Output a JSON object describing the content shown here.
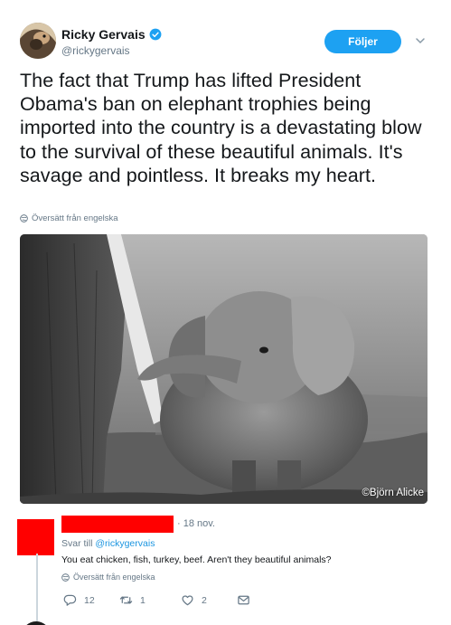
{
  "tweet": {
    "author_name": "Ricky Gervais",
    "author_handle": "@rickygervais",
    "follow_label": "Följer",
    "text": "The fact that Trump has lifted President Obama's ban on elephant trophies being imported into the country is a devastating blow to the survival of these beautiful animals. It's savage and pointless. It breaks my heart.",
    "translate_label": "Översätt från engelska",
    "photo_credit": "©Björn Alicke"
  },
  "reply": {
    "date": "· 18 nov.",
    "reply_to_prefix": "Svar till",
    "reply_to_handle": "@rickygervais",
    "text": "You eat chicken, fish, turkey, beef. Aren't they beautiful animals?",
    "translate_label": "Översätt från engelska",
    "reply_count": "12",
    "retweet_count": "1",
    "like_count": "2"
  },
  "colors": {
    "accent": "#1da1f2",
    "link": "#1b95e0",
    "muted": "#657786",
    "redaction": "#ff0000"
  },
  "icons": [
    "verified-badge-icon",
    "chevron-down-icon",
    "globe-icon",
    "reply-icon",
    "retweet-icon",
    "like-icon",
    "message-icon"
  ]
}
